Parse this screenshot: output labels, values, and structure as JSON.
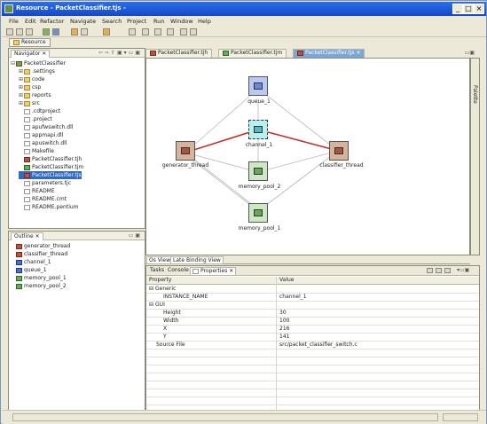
{
  "window": {
    "title": "Resource - PacketClassifier.tjs - ",
    "controls": [
      "_",
      "□",
      "×"
    ]
  },
  "menubar": [
    "File",
    "Edit",
    "Refactor",
    "Navigate",
    "Search",
    "Project",
    "Run",
    "Window",
    "Help"
  ],
  "perspective": {
    "label": "Resource"
  },
  "navigator": {
    "title": "Navigator",
    "items": [
      {
        "label": "PacketClassifier",
        "icon": "project-icon",
        "expander": "⊟"
      },
      {
        "label": ".settings",
        "icon": "folder-icon",
        "expander": "⊞"
      },
      {
        "label": "code",
        "icon": "folder-icon",
        "expander": "⊞"
      },
      {
        "label": "csp",
        "icon": "folder-icon",
        "expander": "⊞"
      },
      {
        "label": "reports",
        "icon": "folder-icon",
        "expander": "⊞"
      },
      {
        "label": "src",
        "icon": "folder-icon",
        "expander": "⊞"
      },
      {
        "label": ".cdtproject",
        "icon": "file-icon",
        "expander": ""
      },
      {
        "label": ".project",
        "icon": "file-icon",
        "expander": ""
      },
      {
        "label": "apufwswitch.dll",
        "icon": "file-icon",
        "expander": ""
      },
      {
        "label": "appmapi.dll",
        "icon": "file-icon",
        "expander": ""
      },
      {
        "label": "apuswitch.dll",
        "icon": "file-icon",
        "expander": ""
      },
      {
        "label": "Makefile",
        "icon": "file-icon",
        "expander": ""
      },
      {
        "label": "PacketClassifier.tjh",
        "icon": "red-icon",
        "expander": ""
      },
      {
        "label": "PacketClassifier.tjm",
        "icon": "green-icon",
        "expander": ""
      },
      {
        "label": "PacketClassifier.tjs",
        "icon": "red-icon",
        "expander": ""
      },
      {
        "label": "parameters.tjc",
        "icon": "file-icon",
        "expander": ""
      },
      {
        "label": "README",
        "icon": "file-icon",
        "expander": ""
      },
      {
        "label": "README.cmt",
        "icon": "file-icon",
        "expander": ""
      },
      {
        "label": "README.pentium",
        "icon": "file-icon",
        "expander": ""
      }
    ],
    "selected_index": 14
  },
  "outline": {
    "title": "Outline",
    "items": [
      {
        "label": "generator_thread",
        "icon": "red-icon"
      },
      {
        "label": "classifier_thread",
        "icon": "red-icon"
      },
      {
        "label": "channel_1",
        "icon": "blue-icon"
      },
      {
        "label": "queue_1",
        "icon": "blue-icon"
      },
      {
        "label": "memory_pool_1",
        "icon": "green-icon"
      },
      {
        "label": "memory_pool_2",
        "icon": "green-icon"
      }
    ]
  },
  "editor": {
    "tabs": [
      {
        "label": "PacketClassifier.tjh",
        "active": false
      },
      {
        "label": "PacketClassifier.tjm",
        "active": false
      },
      {
        "label": "PacketClassifier.tjs",
        "active": true
      }
    ],
    "palette_label": "Palette",
    "nodes": [
      {
        "label": "queue_1",
        "kind": "queue"
      },
      {
        "label": "channel_1",
        "kind": "channel"
      },
      {
        "label": "generator_thread",
        "kind": "thread"
      },
      {
        "label": "classifier_thread",
        "kind": "thread"
      },
      {
        "label": "memory_pool_2",
        "kind": "pool"
      },
      {
        "label": "memory_pool_1",
        "kind": "pool"
      }
    ],
    "view_tabs": [
      "Os View",
      "Late Binding View"
    ],
    "colors": {
      "thread_fill": "#d6b39c",
      "queue_fill": "#b9c8f5",
      "channel_fill": "#b8f0ee",
      "pool_fill": "#cde8c5",
      "highlight_edge": "#c0302a",
      "edge": "#b8b8b8"
    }
  },
  "properties": {
    "tabs": [
      "Tasks",
      "Console",
      "Properties"
    ],
    "active_tab": "Properties",
    "columns": [
      "Property",
      "Value"
    ],
    "rows": [
      {
        "property": "Generic",
        "value": "",
        "group": true,
        "expander": "⊟"
      },
      {
        "property": "INSTANCE_NAME",
        "value": "channel_1",
        "indent": 2
      },
      {
        "property": "GUI",
        "value": "",
        "group": true,
        "expander": "⊟"
      },
      {
        "property": "Height",
        "value": "30",
        "indent": 2
      },
      {
        "property": "Width",
        "value": "100",
        "indent": 2
      },
      {
        "property": "X",
        "value": "216",
        "indent": 2
      },
      {
        "property": "Y",
        "value": "141",
        "indent": 2
      },
      {
        "property": "Source File",
        "value": "src/packet_classifier_switch.c",
        "indent": 1
      }
    ]
  }
}
